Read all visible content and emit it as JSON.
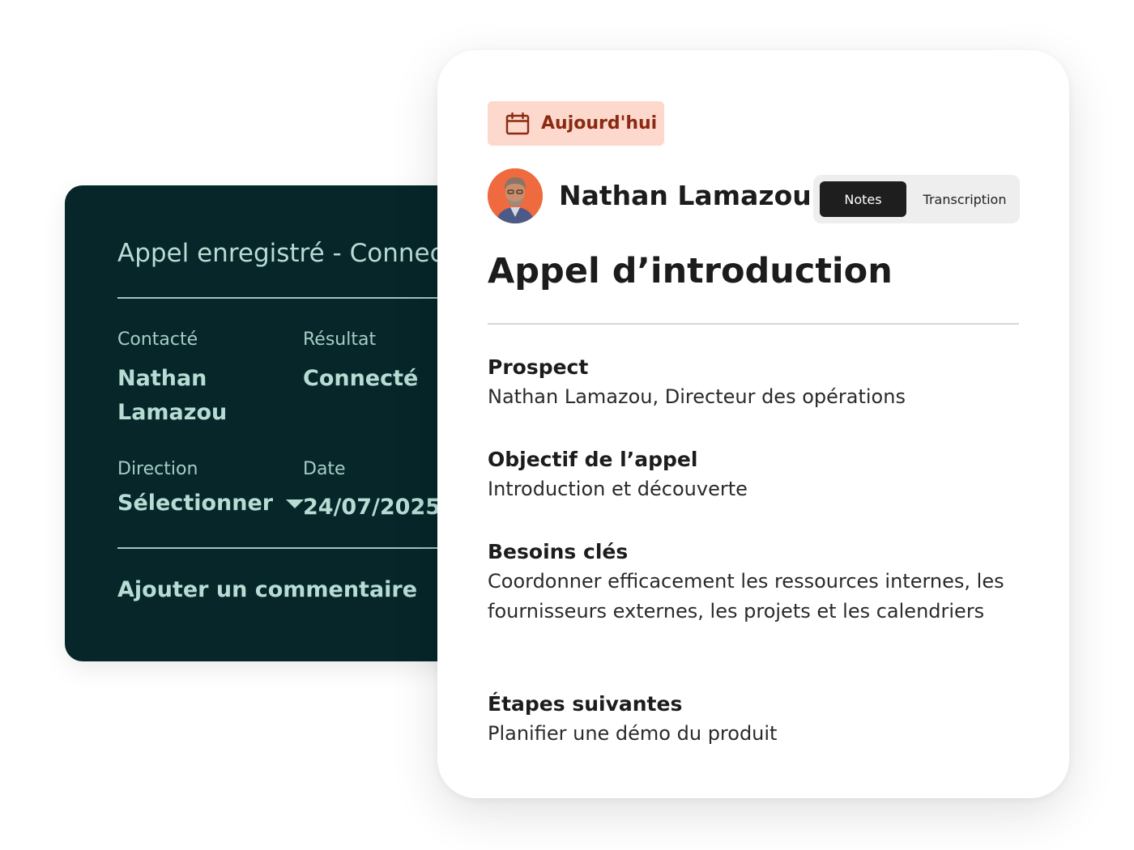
{
  "call_log": {
    "title": "Appel enregistré - Connecté",
    "contacted_label": "Contacté",
    "contacted_value_first": "Nathan",
    "contacted_value_last": "Lamazou",
    "result_label": "Résultat",
    "result_value": "Connecté",
    "direction_label": "Direction",
    "direction_value": "Sélectionner",
    "date_label": "Date",
    "date_value": "24/07/2025",
    "comment_placeholder": "Ajouter un commentaire"
  },
  "notes_card": {
    "date_badge": "Aujourd'hui",
    "date_icon": "calendar-icon",
    "contact_name": "Nathan Lamazou",
    "tabs": [
      {
        "label": "Notes",
        "active": true
      },
      {
        "label": "Transcription",
        "active": false
      }
    ],
    "call_title": "Appel d’introduction",
    "sections": [
      {
        "heading": "Prospect",
        "body": "Nathan Lamazou, Directeur des opérations"
      },
      {
        "heading": "Objectif de l’appel",
        "body": "Introduction et découverte"
      },
      {
        "heading": "Besoins clés",
        "body": "Coordonner efficacement les ressources internes, les fournisseurs externes, les projets et les calendriers"
      },
      {
        "heading": "Étapes suivantes",
        "body": "Planifier une démo du produit"
      }
    ]
  },
  "colors": {
    "dark_card_bg": "#062629",
    "dark_card_text": "#b6dcd3",
    "badge_bg": "#fcd8cd",
    "badge_text": "#8a2a10",
    "active_tab_bg": "#1e1e1e",
    "avatar_bg": "#ef6a3e"
  }
}
